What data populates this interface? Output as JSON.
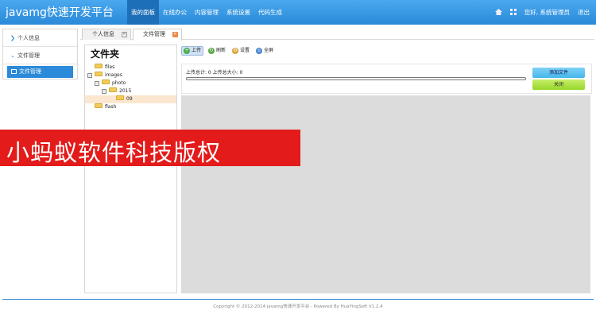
{
  "header": {
    "brand": "javamg快速开发平台",
    "nav": [
      "我的面板",
      "在线办公",
      "内容管理",
      "系统设置",
      "代码生成"
    ],
    "greeting": "您好, 系统管理员",
    "logout": "退出",
    "colors": {
      "bar": "#2b8ad9",
      "active": "#1d6fb8"
    }
  },
  "sidebar": {
    "items": [
      {
        "label": "个人信息",
        "icon": "chevron-right-icon"
      },
      {
        "label": "文件管理",
        "icon": "chevron-down-icon"
      }
    ],
    "sub_item": "文件管理"
  },
  "tabs": [
    {
      "label": "个人信息",
      "close": "✕"
    },
    {
      "label": "文件管理",
      "close": "✕"
    }
  ],
  "tree": {
    "title": "文件夹",
    "nodes": [
      "files",
      "images",
      "photo",
      "2015",
      "09",
      "flash"
    ],
    "expand_symbols": {
      "minus": "−"
    }
  },
  "toolbar": {
    "upload": "上传",
    "refresh": "刷新",
    "settings": "设置",
    "fullscreen": "全屏"
  },
  "upload": {
    "stat": "上传总计: 0 上传总大小: 0",
    "progress": 0,
    "add_button": "添加文件",
    "close_button": "关闭"
  },
  "watermark": "小蚂蚁软件科技版权",
  "footer": "Copyright © 2012-2014 javamg快速开发平台 - Powered By HuaYingSoft V1.2.4"
}
